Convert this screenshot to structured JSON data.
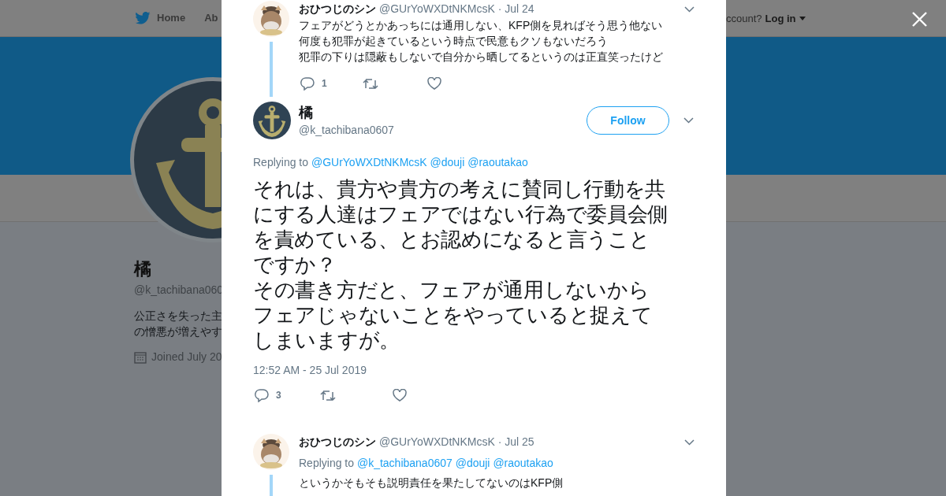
{
  "nav": {
    "items": [
      {
        "label": "Home",
        "kind": "home"
      },
      {
        "label": "Ab",
        "kind": "link"
      }
    ],
    "login_prompt": "ccount?",
    "login": "Log in"
  },
  "profile": {
    "name": "橘",
    "handle": "@k_tachibana060",
    "bio_lines": [
      "公正さを失った主",
      "の憎悪が増えやす"
    ],
    "joined": "Joined July 20"
  },
  "tweets": [
    {
      "kind": "parent",
      "name": "おひつじのシン",
      "handle": "@GUrYoWXDtNKMcsK",
      "date": "· Jul 24",
      "lines": [
        "フェアがどうとかあっちには通用しない、KFP側を見ればそう思う他ない",
        "何度も犯罪が起きているという時点で民意もクソもないだろう",
        "犯罪の下りは隠蔽もしないで自分から晒してるというのは正直笑ったけど"
      ],
      "replies": "1"
    },
    {
      "kind": "main",
      "name": "橘",
      "handle": "@k_tachibana0607",
      "follow": "Follow",
      "replying_label": "Replying to",
      "replying_to": [
        "@GUrYoWXDtNKMcsK",
        "@douji",
        "@raoutakao"
      ],
      "lines": [
        "それは、貴方や貴方の考えに賛同し行動を共",
        "にする人達はフェアではない行為で委員会側",
        "を責めている、とお認めになると言うこと",
        "ですか？",
        "その書き方だと、フェアが通用しないから",
        "フェアじゃないことをやっていると捉えて",
        "しまいますが。"
      ],
      "time": "12:52 AM - 25 Jul 2019",
      "replies": "3"
    },
    {
      "kind": "reply",
      "name": "おひつじのシン",
      "handle": "@GUrYoWXDtNKMcsK",
      "date": "· Jul 25",
      "replying_label": "Replying to",
      "replying_to": [
        "@k_tachibana0607",
        "@douji",
        "@raoutakao"
      ],
      "lines": [
        "というかそもそも説明責任を果たしてないのはKFP側"
      ]
    }
  ]
}
